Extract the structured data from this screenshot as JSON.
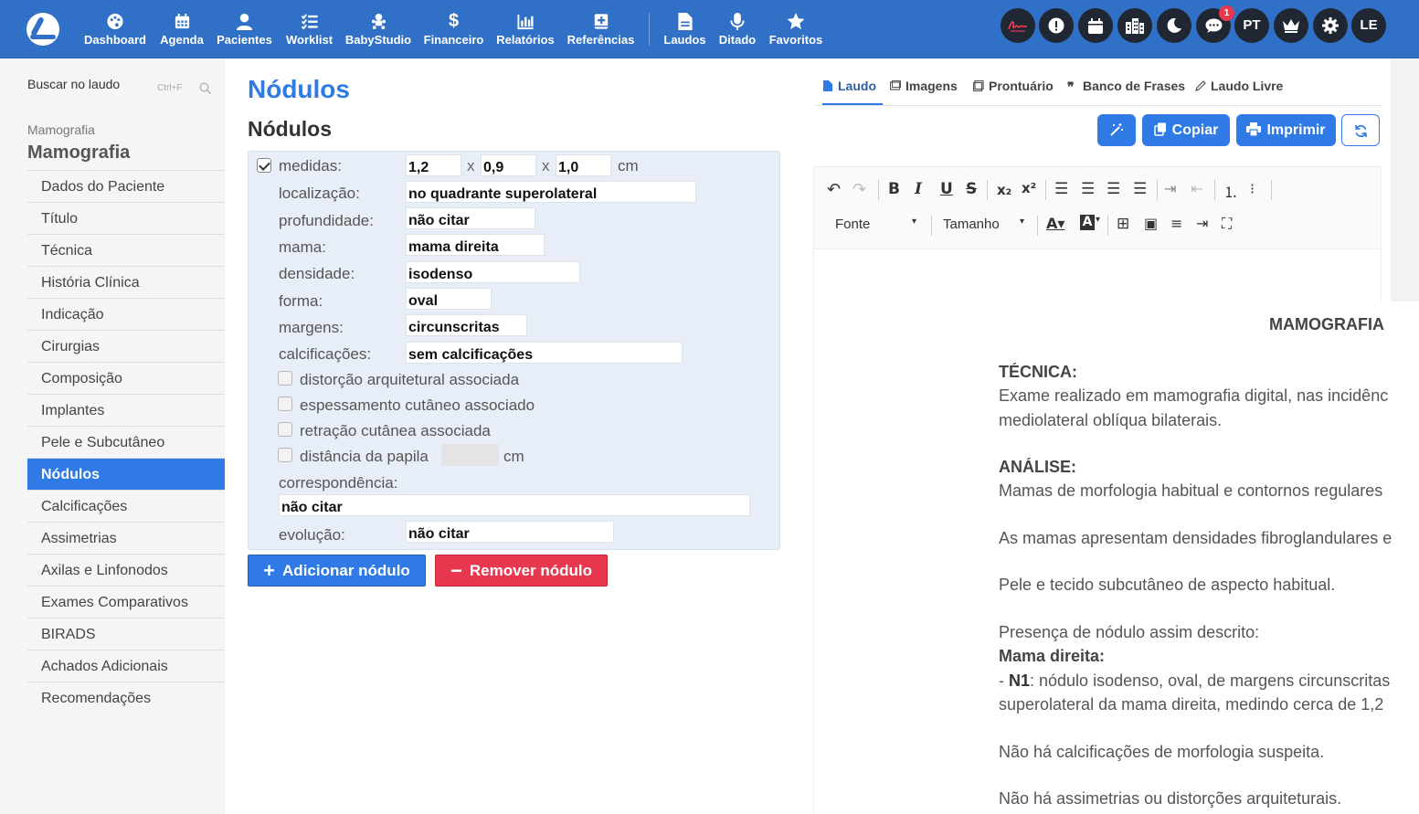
{
  "nav": {
    "items": [
      {
        "label": "Dashboard",
        "icon": "palette-icon"
      },
      {
        "label": "Agenda",
        "icon": "calendar-icon"
      },
      {
        "label": "Pacientes",
        "icon": "user-icon"
      },
      {
        "label": "Worklist",
        "icon": "checklist-icon"
      },
      {
        "label": "BabyStudio",
        "icon": "baby-icon"
      },
      {
        "label": "Financeiro",
        "icon": "dollar-icon"
      },
      {
        "label": "Relatórios",
        "icon": "bar-chart-icon"
      },
      {
        "label": "Referências",
        "icon": "medical-book-icon"
      },
      {
        "label": "Laudos",
        "icon": "document-icon"
      },
      {
        "label": "Ditado",
        "icon": "microphone-icon"
      },
      {
        "label": "Favoritos",
        "icon": "star-icon"
      }
    ],
    "circle_buttons": [
      {
        "icon": "signature-icon",
        "label": ""
      },
      {
        "icon": "alert-icon",
        "label": ""
      },
      {
        "icon": "calendar-icon",
        "label": ""
      },
      {
        "icon": "building-icon",
        "label": ""
      },
      {
        "icon": "moon-icon",
        "label": ""
      },
      {
        "icon": "chat-icon",
        "label": ""
      },
      {
        "icon": "language",
        "label": "PT"
      },
      {
        "icon": "crown-icon",
        "label": ""
      },
      {
        "icon": "gear-icon",
        "label": ""
      },
      {
        "icon": "avatar",
        "label": "LE"
      }
    ],
    "chat_badge": "1"
  },
  "sidebar": {
    "search_label": "Buscar no laudo",
    "search_shortcut": "Ctrl+F",
    "section_small": "Mamografia",
    "section_title": "Mamografia",
    "items": [
      "Dados do Paciente",
      "Título",
      "Técnica",
      "História Clínica",
      "Indicação",
      "Cirurgias",
      "Composição",
      "Implantes",
      "Pele e Subcutâneo",
      "Nódulos",
      "Calcificações",
      "Assimetrias",
      "Axilas e Linfonodos",
      "Exames Comparativos",
      "BIRADS",
      "Achados Adicionais",
      "Recomendações"
    ],
    "active_index": 9
  },
  "form": {
    "title": "Nódulos",
    "subtitle": "Nódulos",
    "medidas_label": "medidas:",
    "medida1": "1,2",
    "medida2": "0,9",
    "medida3": "1,0",
    "times": "x",
    "unit": "cm",
    "localizacao_label": "localização:",
    "localizacao": "no quadrante superolateral",
    "profundidade_label": "profundidade:",
    "profundidade": "não citar",
    "mama_label": "mama:",
    "mama": "mama direita",
    "densidade_label": "densidade:",
    "densidade": "isodenso",
    "forma_label": "forma:",
    "forma": "oval",
    "margens_label": "margens:",
    "margens": "circunscritas",
    "calcificacoes_label": "calcificações:",
    "calcificacoes": "sem calcificações",
    "distorcao_label": "distorção arquitetural associada",
    "espessamento_label": "espessamento cutâneo associado",
    "retracao_label": "retração cutânea associada",
    "distancia_label": "distância da papila",
    "distancia_unit": "cm",
    "correspondencia_label": "correspondência:",
    "correspondencia": "não citar",
    "evolucao_label": "evolução:",
    "evolucao": "não citar",
    "add_button": "Adicionar nódulo",
    "remove_button": "Remover nódulo"
  },
  "report": {
    "tabs": [
      "Laudo",
      "Imagens",
      "Prontuário",
      "Banco de Frases",
      "Laudo Livre"
    ],
    "active_tab": 0,
    "copy_button": "Copiar",
    "print_button": "Imprimir",
    "font_dropdown": "Fonte",
    "size_dropdown": "Tamanho",
    "doc_title": "MAMOGRAFIA",
    "tecnica_h": "TÉCNICA:",
    "tecnica_1": "Exame realizado em mamografia digital, nas incidênc",
    "tecnica_2": "mediolateral oblíqua bilaterais.",
    "analise_h": "ANÁLISE:",
    "analise_1": "Mamas de morfologia habitual e contornos regulares",
    "analise_2": "As mamas apresentam densidades fibroglandulares e",
    "analise_3": "Pele e tecido subcutâneo de aspecto habitual.",
    "presenca": "Presença de nódulo assim descrito:",
    "mama_direita_h": "Mama direita:",
    "n1_prefix": "- ",
    "n1_bold": "N1",
    "n1_rest": ": nódulo isodenso, oval, de margens circunscritas",
    "n1_2": "superolateral da mama direita, medindo cerca de 1,2",
    "calc_line": "Não há calcificações de morfologia suspeita.",
    "assim_line": "Não há assimetrias ou distorções arquiteturais."
  },
  "colors": {
    "topbar": "#3070c6",
    "accent": "#2f7ae5",
    "danger": "#e8384f",
    "circle_button": "#1f2733"
  }
}
